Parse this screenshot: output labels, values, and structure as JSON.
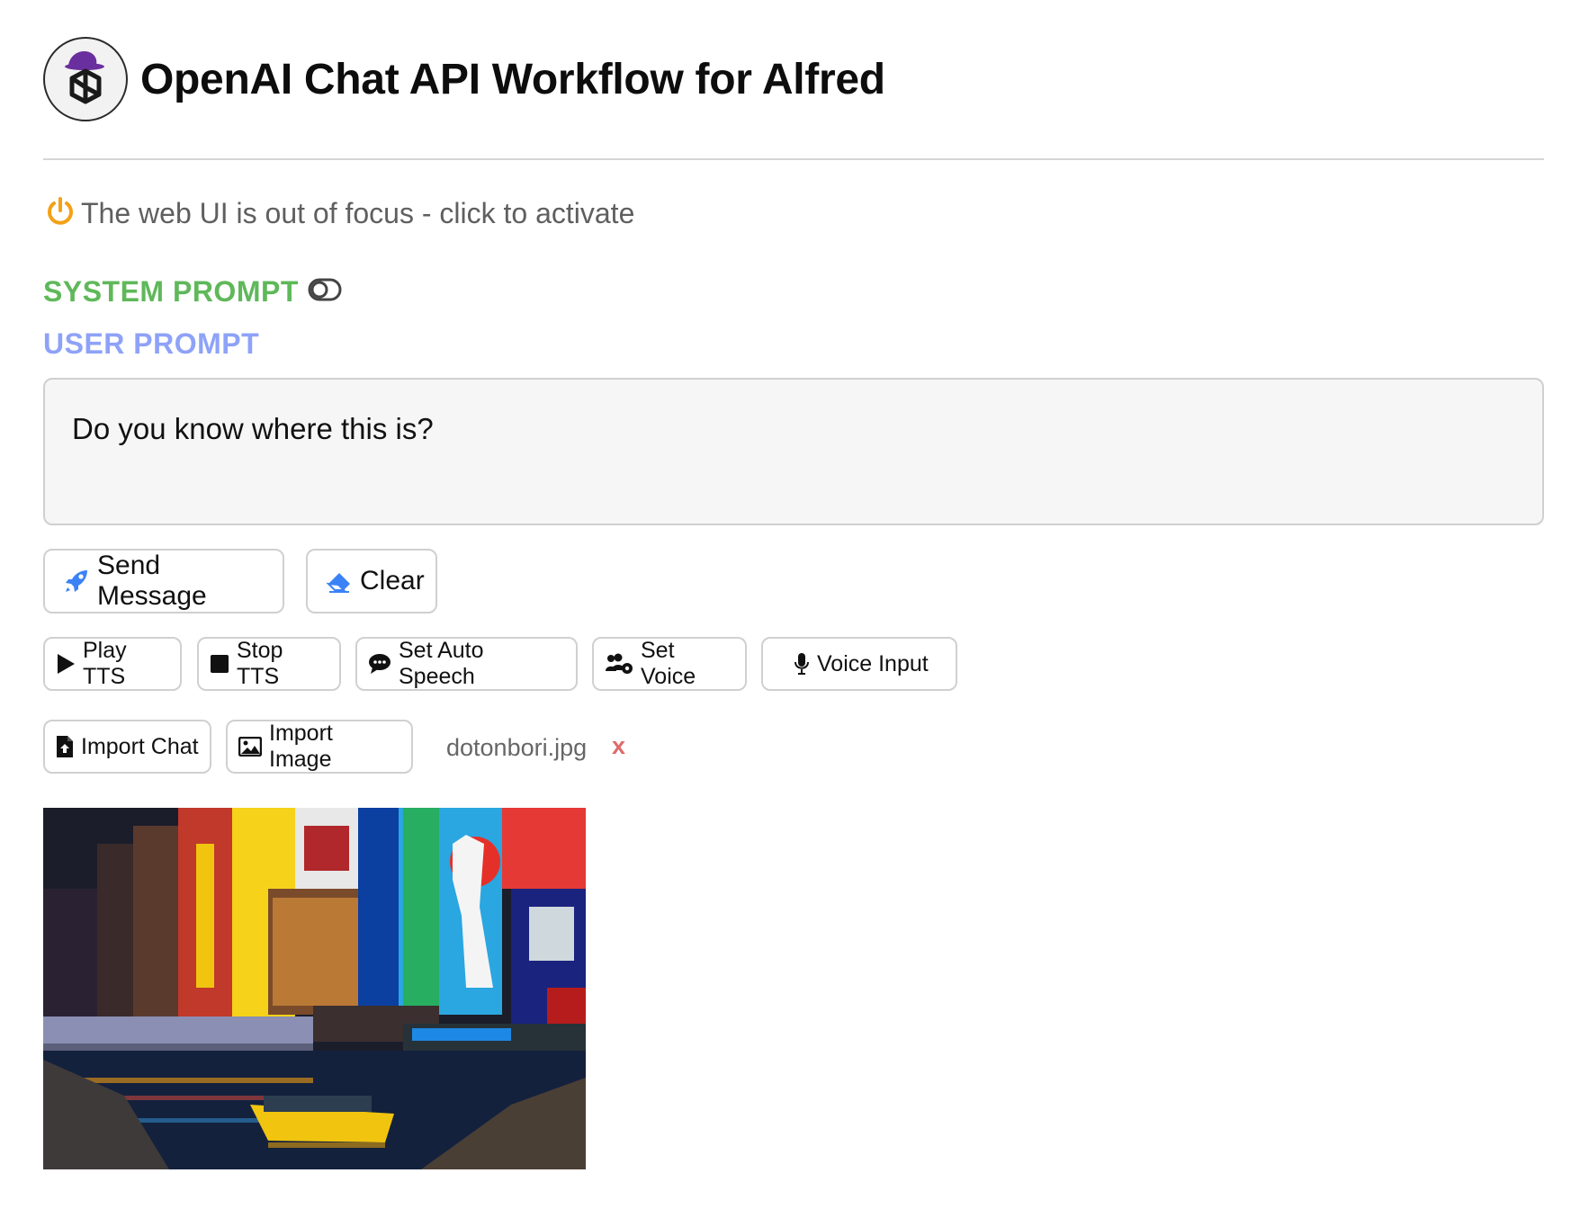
{
  "header": {
    "title": "OpenAI Chat API Workflow for Alfred",
    "logo_icon": "openai-logo-icon"
  },
  "status": {
    "focus_text": "The web UI is out of focus - click to activate",
    "icon": "power-icon",
    "icon_color": "#f3a116"
  },
  "prompts": {
    "system_label": "SYSTEM PROMPT",
    "system_color": "#5fb85a",
    "system_toggle_icon": "toggle-icon",
    "user_label": "USER PROMPT",
    "user_color": "#8ea2f8",
    "user_value": "Do you know where this is?"
  },
  "actions": {
    "send_label": "Send Message",
    "send_icon": "rocket-icon",
    "clear_label": "Clear",
    "clear_icon": "eraser-icon",
    "accent": "#3b82f6"
  },
  "audio": {
    "play_tts": "Play TTS",
    "stop_tts": "Stop TTS",
    "auto_speech": "Set Auto Speech",
    "set_voice": "Set Voice",
    "voice_input": "Voice Input"
  },
  "imports": {
    "import_chat": "Import Chat",
    "import_image": "Import Image",
    "file_name": "dotonbori.jpg",
    "remove_label": "x"
  }
}
